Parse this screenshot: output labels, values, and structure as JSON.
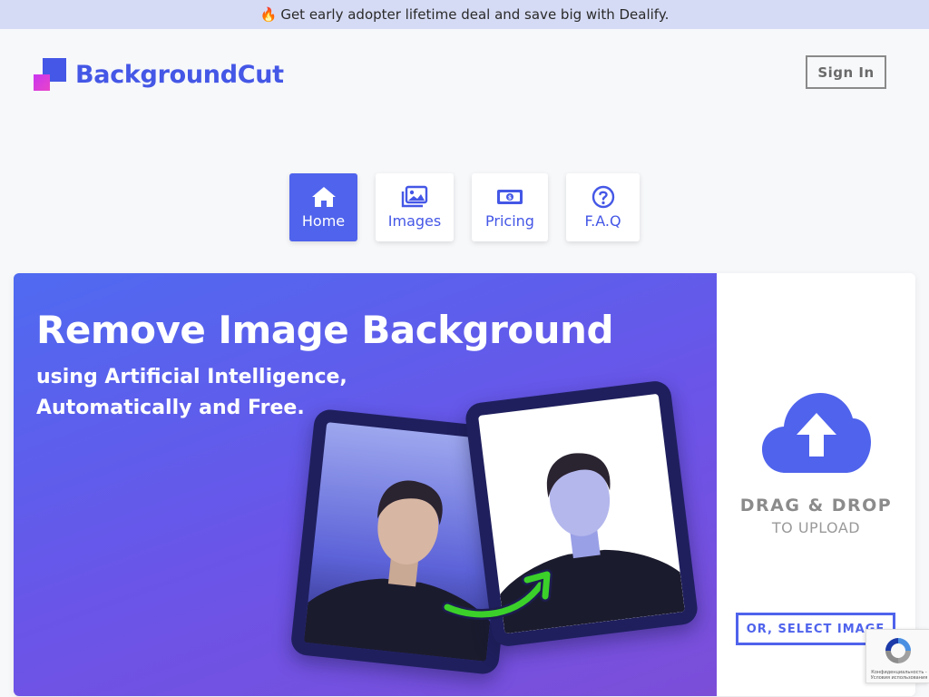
{
  "promo": {
    "emoji": "🔥",
    "text": "Get early adopter lifetime deal and save big with Dealify."
  },
  "header": {
    "brand": "BackgroundCut",
    "signin_label": "Sign In"
  },
  "nav": {
    "items": [
      {
        "label": "Home",
        "icon": "home-icon",
        "active": true
      },
      {
        "label": "Images",
        "icon": "images-icon",
        "active": false
      },
      {
        "label": "Pricing",
        "icon": "money-icon",
        "active": false
      },
      {
        "label": "F.A.Q",
        "icon": "question-icon",
        "active": false
      }
    ]
  },
  "hero": {
    "title": "Remove Image Background",
    "subtitle_line1": "using Artificial Intelligence,",
    "subtitle_line2": "Automatically and Free."
  },
  "upload": {
    "icon": "cloud-upload-icon",
    "drag_title": "DRAG & DROP",
    "drag_sub": "TO UPLOAD",
    "select_label": "OR, SELECT IMAGE"
  },
  "recaptcha": {
    "text": "Конфиденциальность - Условия использования"
  },
  "colors": {
    "brand": "#4457e6",
    "accent": "#4f63ec",
    "promo_bg": "#d6dbf5",
    "arrow": "#3bd12a"
  }
}
